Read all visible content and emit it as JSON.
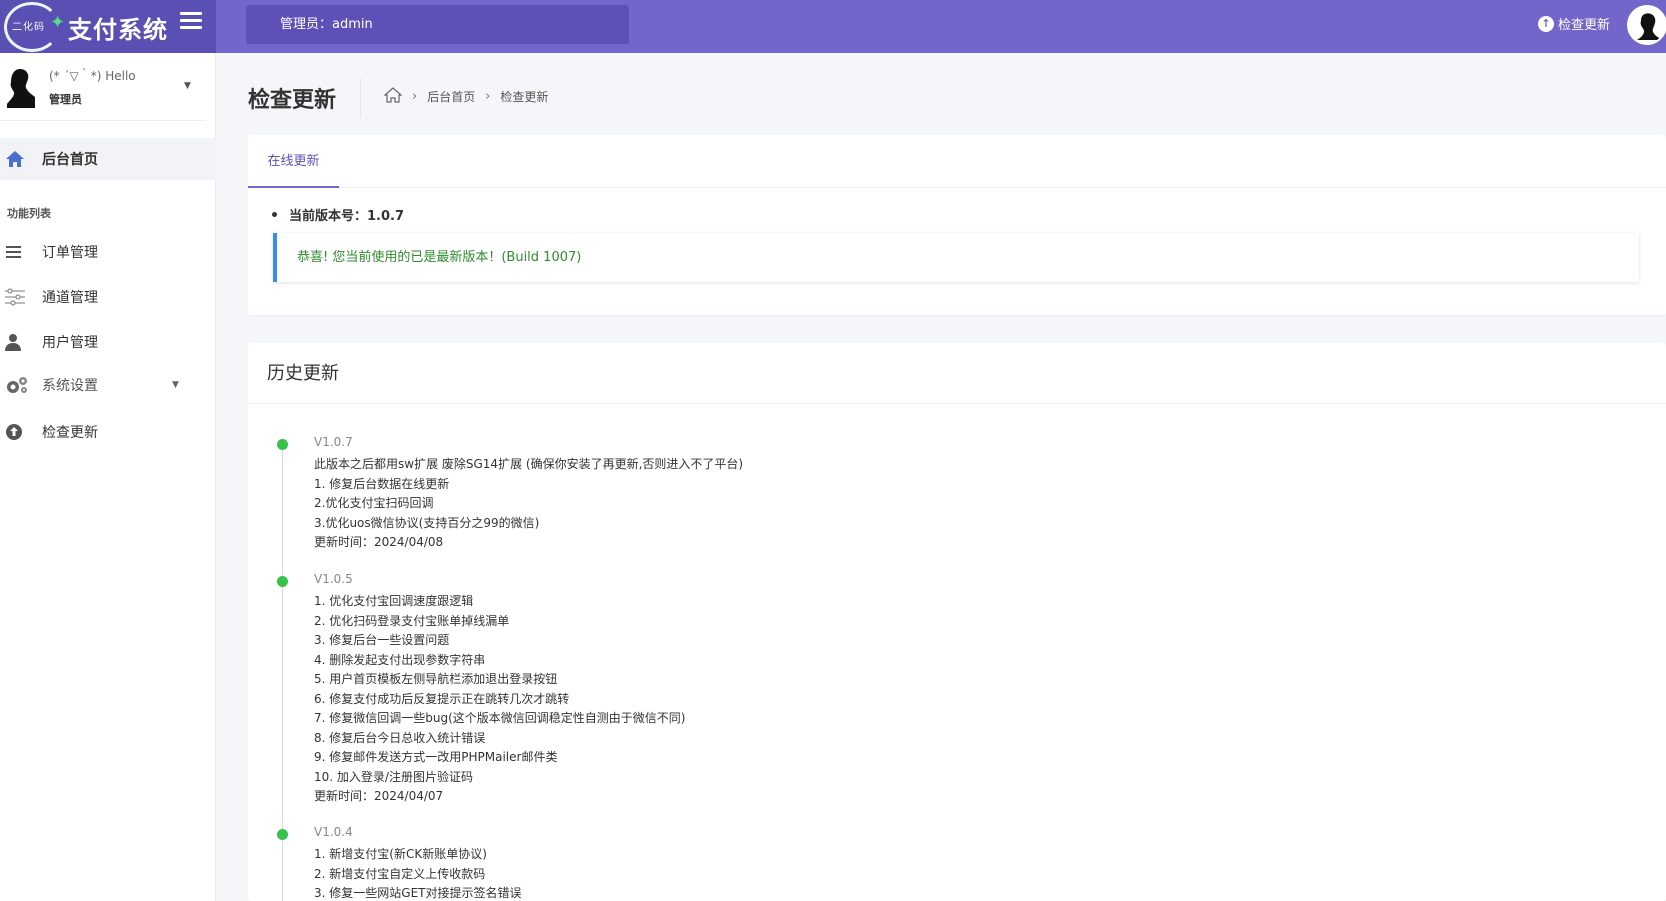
{
  "header": {
    "logo_small": "二化码",
    "logo_text": "支付系统",
    "admin_label": "管理员：admin",
    "check_update": "检查更新"
  },
  "sidebar": {
    "hello": "(* ´▽｀*) Hello",
    "role": "管理员",
    "home": "后台首页",
    "section_title": "功能列表",
    "items": [
      {
        "label": "订单管理",
        "icon": "list-icon"
      },
      {
        "label": "通道管理",
        "icon": "sliders-icon"
      },
      {
        "label": "用户管理",
        "icon": "user-icon"
      },
      {
        "label": "系统设置",
        "icon": "gears-icon"
      },
      {
        "label": "检查更新",
        "icon": "upload-circle-icon"
      }
    ]
  },
  "page": {
    "title": "检查更新",
    "breadcrumb": [
      "后台首页",
      "检查更新"
    ]
  },
  "online_update": {
    "tab": "在线更新",
    "current_version_label": "当前版本号：",
    "current_version": "1.0.7",
    "alert": "恭喜! 您当前使用的已是最新版本！(Build 1007)"
  },
  "history": {
    "title": "历史更新",
    "entries": [
      {
        "version": "V1.0.7",
        "lines": [
          "此版本之后都用sw扩展 废除SG14扩展 (确保你安装了再更新,否则进入不了平台)",
          "1. 修复后台数据在线更新",
          "2.优化支付宝扫码回调",
          "3.优化uos微信协议(支持百分之99的微信)",
          "更新时间：2024/04/08"
        ]
      },
      {
        "version": "V1.0.5",
        "lines": [
          "1. 优化支付宝回调速度跟逻辑",
          "2. 优化扫码登录支付宝账单掉线漏单",
          "3. 修复后台一些设置问题",
          "4. 删除发起支付出现参数字符串",
          "5. 用户首页模板左侧导航栏添加退出登录按钮",
          "6. 修复支付成功后反复提示正在跳转几次才跳转",
          "7. 修复微信回调一些bug(这个版本微信回调稳定性自测由于微信不同)",
          "8. 修复后台今日总收入统计错误",
          "9. 修复邮件发送方式一改用PHPMailer邮件类",
          "10. 加入登录/注册图片验证码",
          "更新时间：2024/04/07"
        ]
      },
      {
        "version": "V1.0.4",
        "lines": [
          "1. 新增支付宝(新CK新账单协议)",
          "2. 新增支付宝自定义上传收款码",
          "3. 修复一些网站GET对接提示签名错误"
        ]
      }
    ]
  }
}
